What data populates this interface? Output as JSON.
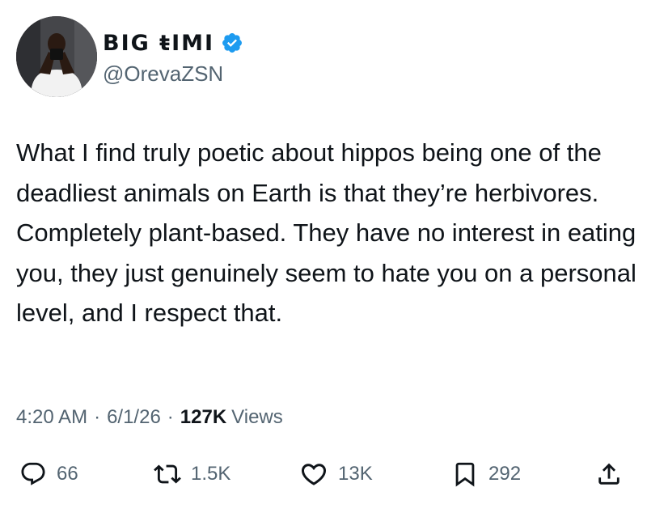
{
  "author": {
    "display_name": "BIG ŧIMI",
    "handle": "@OrevaZSN",
    "verified": true,
    "verified_color": "#1d9bf0"
  },
  "tweet": {
    "text": "What I find truly poetic about hippos being one of the deadliest animals on Earth is that they’re herbivores. Completely plant-based. They have no interest in eating you, they just genuinely seem to hate you on a personal level, and I respect that."
  },
  "meta": {
    "time": "4:20 AM",
    "separator": "·",
    "date": "6/1/26",
    "views_count": "127K",
    "views_label": "Views"
  },
  "actions": {
    "reply": {
      "icon": "reply-icon",
      "count": "66"
    },
    "retweet": {
      "icon": "retweet-icon",
      "count": "1.5K"
    },
    "like": {
      "icon": "heart-icon",
      "count": "13K"
    },
    "bookmark": {
      "icon": "bookmark-icon",
      "count": "292"
    },
    "share": {
      "icon": "share-icon"
    }
  },
  "colors": {
    "text_primary": "#0f1419",
    "text_secondary": "#536471"
  }
}
